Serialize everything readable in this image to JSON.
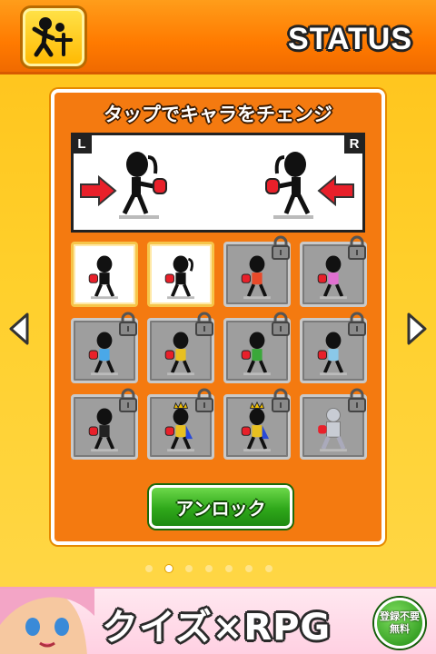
{
  "header": {
    "title": "STATUS",
    "home_icon": "stick-figure-icon"
  },
  "panel": {
    "caption": "タップでキャラをチェンジ",
    "left_badge": "L",
    "right_badge": "R"
  },
  "grid": {
    "rows": [
      [
        "unlocked",
        "unlocked",
        "locked",
        "locked"
      ],
      [
        "locked",
        "locked",
        "locked",
        "locked"
      ],
      [
        "locked",
        "locked",
        "locked",
        "locked"
      ]
    ]
  },
  "unlock_button": {
    "label": "アンロック"
  },
  "pager": {
    "count": 7,
    "active_index": 1
  },
  "banner": {
    "headline": "クイズ×RPG",
    "badge_line1": "登録不要",
    "badge_line2": "無料"
  },
  "colors": {
    "accent": "#f47a10",
    "header": "#ff7a00",
    "button": "#2fa81a",
    "glove": "#e8202a"
  }
}
